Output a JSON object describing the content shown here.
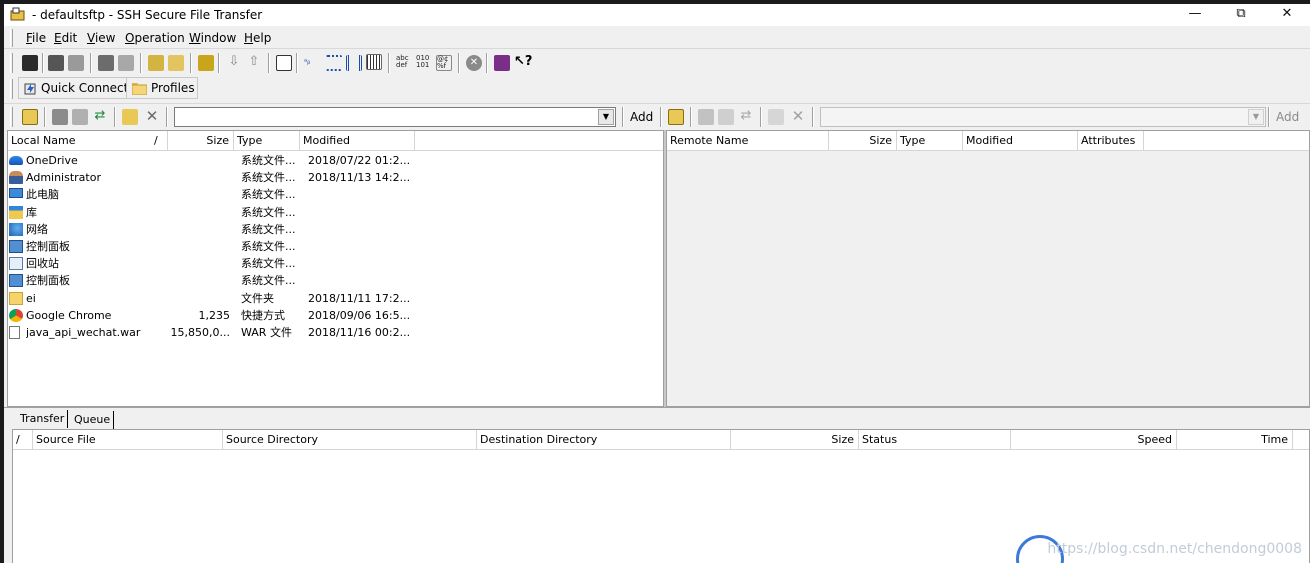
{
  "window": {
    "title": "- defaultsftp - SSH Secure File Transfer",
    "minimize_glyph": "—",
    "maximize_glyph": "⧉",
    "close_glyph": "✕"
  },
  "menu": [
    {
      "label": "File",
      "u": "F",
      "rest": "ile"
    },
    {
      "label": "Edit",
      "u": "E",
      "rest": "dit"
    },
    {
      "label": "View",
      "u": "V",
      "rest": "iew"
    },
    {
      "label": "Operation",
      "u": "O",
      "rest": "peration"
    },
    {
      "label": "Window",
      "u": "W",
      "rest": "indow"
    },
    {
      "label": "Help",
      "u": "H",
      "rest": "elp"
    }
  ],
  "toolbar2": {
    "quick_connect": "Quick Connect",
    "profiles": "Profiles"
  },
  "local": {
    "path_value": "",
    "add_label": "Add",
    "columns": {
      "name": "Local Name",
      "sort": "/",
      "size": "Size",
      "type": "Type",
      "modified": "Modified"
    },
    "rows": [
      {
        "icon": "onedrive-icon",
        "name": "OneDrive",
        "size": "",
        "type": "系统文件...",
        "modified": "2018/07/22 01:2..."
      },
      {
        "icon": "user-icon",
        "name": "Administrator",
        "size": "",
        "type": "系统文件...",
        "modified": "2018/11/13 14:2..."
      },
      {
        "icon": "computer-icon",
        "name": "此电脑",
        "size": "",
        "type": "系统文件...",
        "modified": ""
      },
      {
        "icon": "library-icon",
        "name": "库",
        "size": "",
        "type": "系统文件...",
        "modified": ""
      },
      {
        "icon": "network-icon",
        "name": "网络",
        "size": "",
        "type": "系统文件...",
        "modified": ""
      },
      {
        "icon": "control-panel-icon",
        "name": "控制面板",
        "size": "",
        "type": "系统文件...",
        "modified": ""
      },
      {
        "icon": "recycle-bin-icon",
        "name": "回收站",
        "size": "",
        "type": "系统文件...",
        "modified": ""
      },
      {
        "icon": "control-panel-icon",
        "name": "控制面板",
        "size": "",
        "type": "系统文件...",
        "modified": ""
      },
      {
        "icon": "folder-icon",
        "name": "ei",
        "size": "",
        "type": "文件夹",
        "modified": "2018/11/11 17:2..."
      },
      {
        "icon": "chrome-icon",
        "name": "Google Chrome",
        "size": "1,235",
        "type": "快捷方式",
        "modified": "2018/09/06 16:5..."
      },
      {
        "icon": "file-icon",
        "name": "java_api_wechat.war",
        "size": "15,850,0...",
        "type": "WAR 文件",
        "modified": "2018/11/16 00:2..."
      }
    ]
  },
  "remote": {
    "path_value": "",
    "add_label": "Add",
    "columns": {
      "name": "Remote Name",
      "size": "Size",
      "type": "Type",
      "modified": "Modified",
      "attributes": "Attributes"
    }
  },
  "transfer": {
    "tabs": [
      "Transfer",
      "Queue"
    ],
    "columns": {
      "sort": "/",
      "source_file": "Source File",
      "source_dir": "Source Directory",
      "dest_dir": "Destination Directory",
      "size": "Size",
      "status": "Status",
      "speed": "Speed",
      "time": "Time"
    }
  },
  "watermark": "https://blog.csdn.net/chendong0008",
  "colors": {
    "window_bg": "#f0f0f0",
    "pane_bg": "#ffffff",
    "onedrive": "#1f6fd1",
    "folder": "#f6d36b",
    "accent_circle": "#3b7ad9"
  }
}
